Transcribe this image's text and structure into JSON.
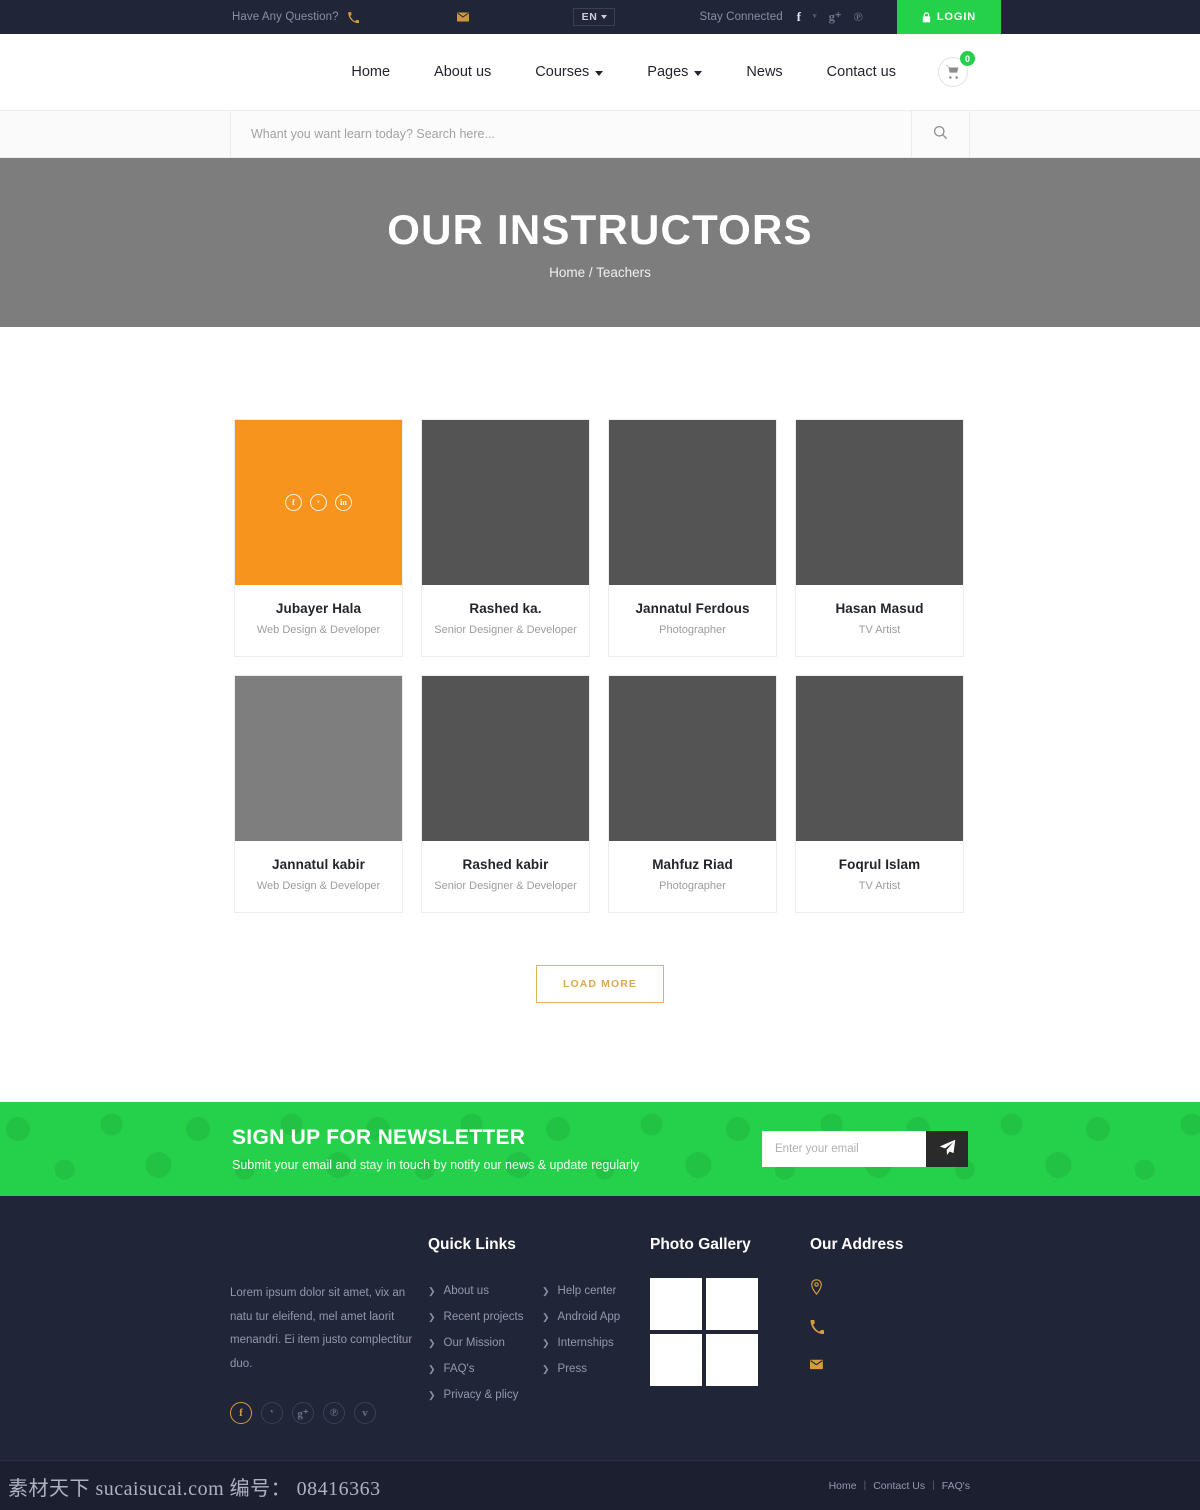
{
  "topbar": {
    "question_label": "Have Any Question?",
    "phone_icon": "phone-icon",
    "mail_icon": "mail-icon",
    "language": "EN",
    "stay_connected_label": "Stay Connected",
    "socials": [
      {
        "name": "facebook-icon",
        "glyph": "f",
        "dim": false
      },
      {
        "name": "twitter-icon",
        "glyph": "ᵛ",
        "dim": true
      },
      {
        "name": "google-plus-icon",
        "glyph": "g⁺",
        "dim": true
      },
      {
        "name": "pinterest-icon",
        "glyph": "℗",
        "dim": true
      }
    ],
    "login_label": "LOGIN"
  },
  "nav": {
    "items": [
      {
        "label": "Home",
        "caret": false
      },
      {
        "label": "About us",
        "caret": false
      },
      {
        "label": "Courses",
        "caret": true
      },
      {
        "label": "Pages",
        "caret": true
      },
      {
        "label": "News",
        "caret": false
      },
      {
        "label": "Contact us",
        "caret": false
      }
    ],
    "cart_count": "0"
  },
  "search": {
    "placeholder": "Whant you want learn today? Search here...",
    "value": ""
  },
  "hero": {
    "title": "OUR INSTRUCTORS",
    "breadcrumb": "Home / Teachers"
  },
  "team": {
    "cards": [
      {
        "name": "Jubayer Hala",
        "role": "Web Design & Developer",
        "img_color": "#f7941d",
        "active": true
      },
      {
        "name": "Rashed ka.",
        "role": "Senior Designer & Developer",
        "img_color": "#545454",
        "active": false
      },
      {
        "name": "Jannatul Ferdous",
        "role": "Photographer",
        "img_color": "#545454",
        "active": false
      },
      {
        "name": "Hasan Masud",
        "role": "TV Artist",
        "img_color": "#545454",
        "active": false
      },
      {
        "name": "Jannatul kabir",
        "role": "Web Design & Developer",
        "img_color": "#7e7e7e",
        "active": false
      },
      {
        "name": "Rashed kabir",
        "role": "Senior Designer & Developer",
        "img_color": "#545454",
        "active": false
      },
      {
        "name": "Mahfuz Riad",
        "role": "Photographer",
        "img_color": "#545454",
        "active": false
      },
      {
        "name": "Foqrul Islam",
        "role": "TV Artist",
        "img_color": "#545454",
        "active": false
      }
    ],
    "card_socials": [
      {
        "name": "facebook-icon",
        "glyph": "f"
      },
      {
        "name": "twitter-icon",
        "glyph": "ᵛ"
      },
      {
        "name": "linkedin-icon",
        "glyph": "in"
      }
    ],
    "load_more_label": "LOAD MORE"
  },
  "newsletter": {
    "title": "SIGN UP FOR NEWSLETTER",
    "subtitle": "Submit your email and stay in touch by notify our news & update regularly",
    "placeholder": "Enter your email",
    "value": "",
    "send_icon": "paper-plane-icon",
    "accent": "#25d04a"
  },
  "footer": {
    "about_text": "Lorem ipsum dolor sit amet, vix an natu tur eleifend, mel amet laorit menandri. Ei item justo complectitur duo.",
    "socials": [
      {
        "name": "facebook-icon",
        "glyph": "f",
        "active": true
      },
      {
        "name": "twitter-icon",
        "glyph": "ᵛ",
        "active": false
      },
      {
        "name": "google-plus-icon",
        "glyph": "g⁺",
        "active": false
      },
      {
        "name": "pinterest-icon",
        "glyph": "℗",
        "active": false
      },
      {
        "name": "vimeo-icon",
        "glyph": "v",
        "active": false
      }
    ],
    "quick_links_title": "Quick Links",
    "quick_links": [
      "About us",
      "Help center",
      "Recent projects",
      "Android App",
      "Our Mission",
      "Internships",
      "FAQ's",
      "Press",
      "Privacy & plicy"
    ],
    "gallery_title": "Photo Gallery",
    "gallery_items": [
      "thumb-1",
      "thumb-2",
      "thumb-3",
      "thumb-4"
    ],
    "address_title": "Our Address",
    "address_rows": [
      {
        "icon": "map-pin-icon",
        "text": ""
      },
      {
        "icon": "phone-icon",
        "text": ""
      },
      {
        "icon": "mail-icon",
        "text": ""
      }
    ]
  },
  "bottombar": {
    "links": [
      "Home",
      "Contact Us",
      "FAQ's"
    ],
    "separator": "|"
  },
  "watermark": {
    "text": "素材天下 sucaisucai.com 编号： 08416363"
  }
}
